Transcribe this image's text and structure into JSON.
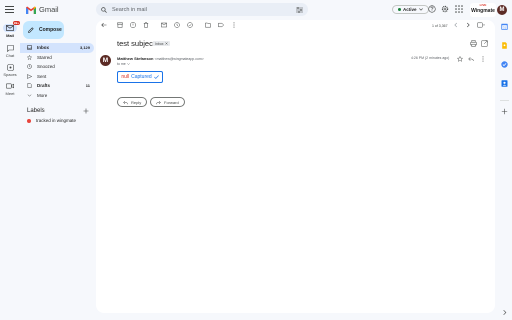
{
  "app": {
    "name": "Gmail"
  },
  "rail": {
    "items": [
      {
        "label": "Mail",
        "badge": "99+"
      },
      {
        "label": "Chat"
      },
      {
        "label": "Spaces"
      },
      {
        "label": "Meet"
      }
    ]
  },
  "search": {
    "placeholder": "Search in mail"
  },
  "header": {
    "status": "Active",
    "wingmate_tag": "LIVE",
    "wingmate_name": "Wingmate",
    "avatar_letter": "M"
  },
  "compose": {
    "label": "Compose"
  },
  "nav": {
    "items": [
      {
        "label": "Inbox",
        "count": "3,129"
      },
      {
        "label": "Starred",
        "count": ""
      },
      {
        "label": "Snoozed",
        "count": ""
      },
      {
        "label": "Sent",
        "count": ""
      },
      {
        "label": "Drafts",
        "count": "11"
      },
      {
        "label": "More",
        "count": ""
      }
    ]
  },
  "labels": {
    "title": "Labels",
    "items": [
      {
        "label": "tracked in wingmate",
        "color": "#e8453c"
      }
    ]
  },
  "toolbar": {
    "pager": "1 of 3,367"
  },
  "email": {
    "subject": "test subject",
    "folder_chip": "Inbox",
    "sender_name": "Matthew Stefanson",
    "sender_email": "<matthew@wingmateapp.com>",
    "to": "to me",
    "date": "4:26 PM (2 minutes ago)",
    "avatar_letter": "M",
    "captured_prefix": "null",
    "captured_word": "Captured"
  },
  "actions": {
    "reply": "Reply",
    "forward": "Forward"
  },
  "colors": {
    "accent": "#1a73e8",
    "compose": "#c2e7ff",
    "nav_active": "#d3e3fd",
    "avatar": "#5c2b25"
  }
}
